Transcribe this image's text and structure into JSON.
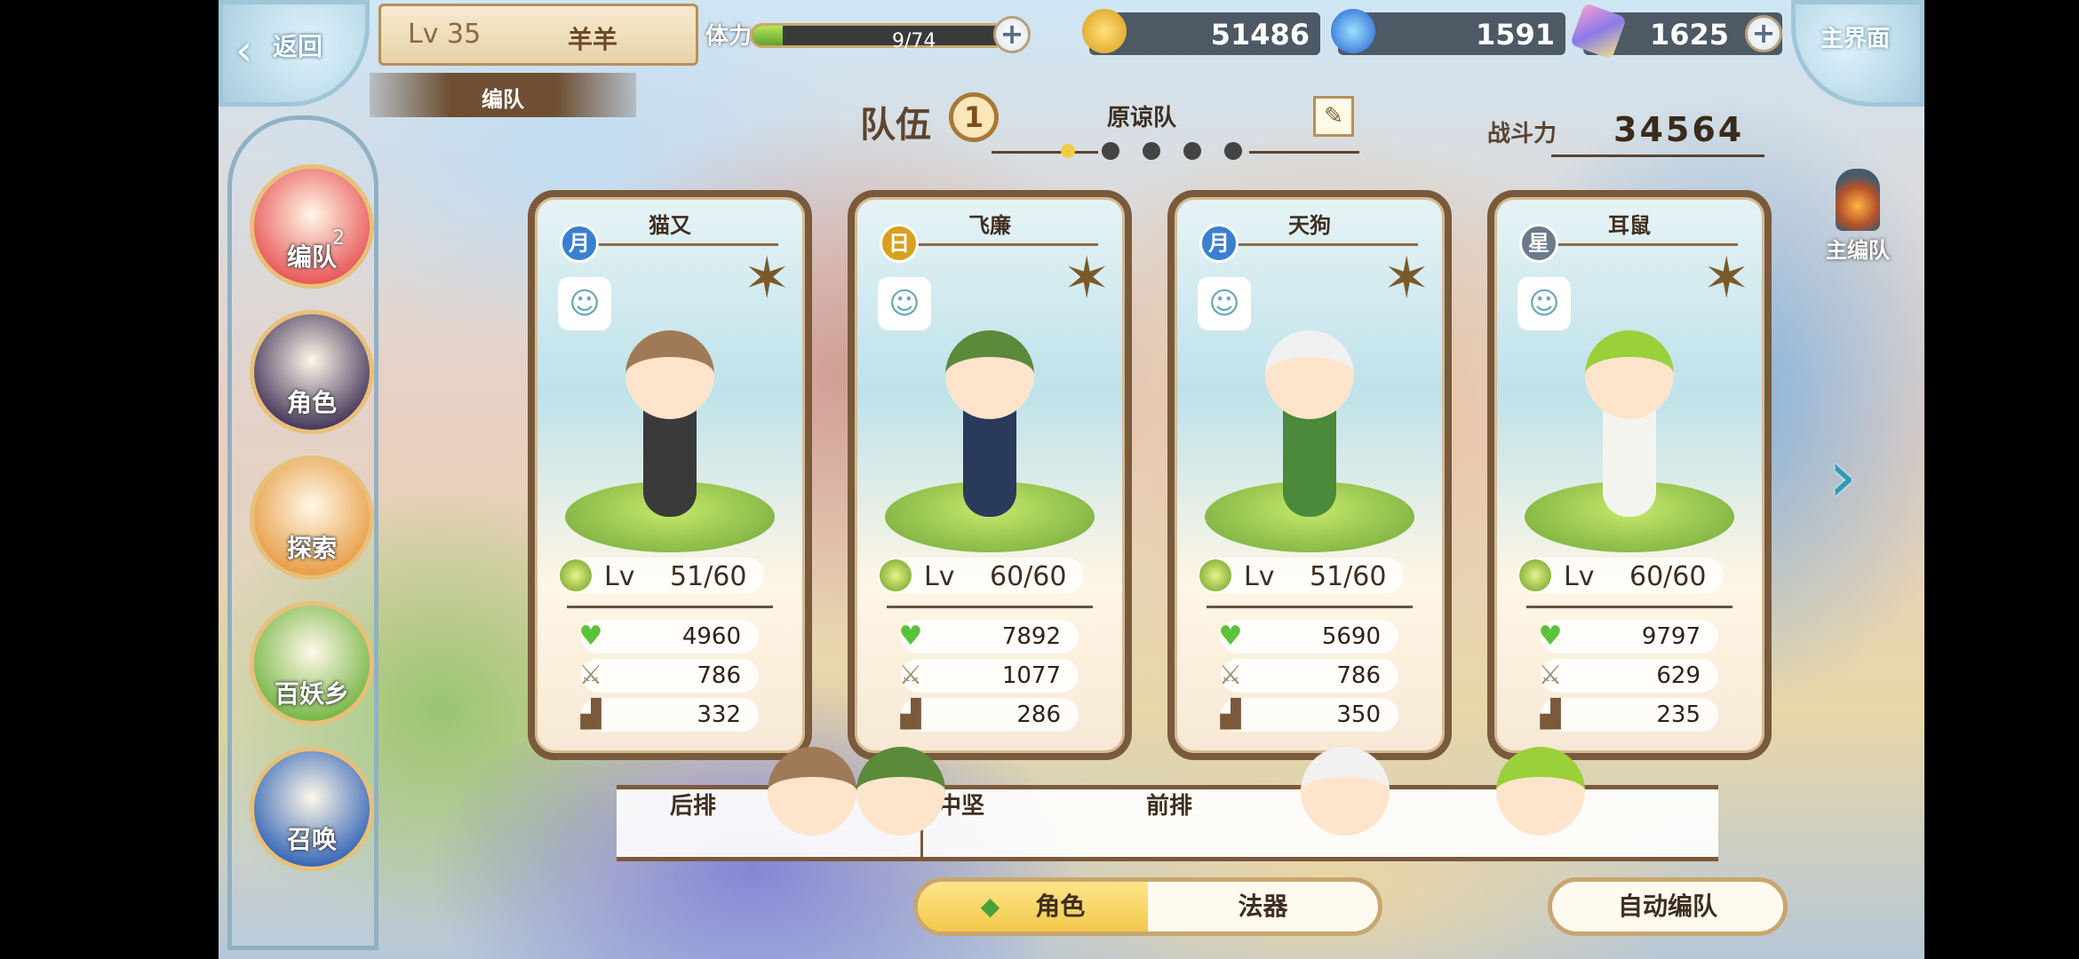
{
  "header": {
    "back_label": "返回",
    "player_level": "Lv 35",
    "player_name": "羊羊",
    "section_title": "编队",
    "stamina_label": "体力",
    "stamina_value": "9/74",
    "stamina_fraction": 0.12,
    "gold": "51486",
    "soul": "1591",
    "crystal": "1625",
    "home_label": "主界面"
  },
  "nav": [
    {
      "label": "编队",
      "badge": "2",
      "icon": "formation-icon",
      "color": "#e85a5a"
    },
    {
      "label": "角色",
      "icon": "character-icon",
      "color": "#4a3b5e"
    },
    {
      "label": "探索",
      "icon": "explore-icon",
      "color": "#e8a04a"
    },
    {
      "label": "百妖乡",
      "icon": "village-icon",
      "color": "#7ab84a"
    },
    {
      "label": "召唤",
      "icon": "summon-icon",
      "color": "#3a6ab8"
    }
  ],
  "team": {
    "label": "队伍",
    "number": "1",
    "name": "原谅队",
    "power_label": "战斗力",
    "power": "34564",
    "page_count": 5,
    "active_page": 0
  },
  "main_team_label": "主编队",
  "cards": [
    {
      "name": "猫又",
      "element": "月",
      "element_color": "#3b7fd0",
      "level_label": "Lv",
      "level": "51/60",
      "hp": "4960",
      "atk": "786",
      "spd": "332",
      "hair": "#a07a56",
      "outfit": "#3a3a3a"
    },
    {
      "name": "飞廉",
      "element": "日",
      "element_color": "#d8a020",
      "level_label": "Lv",
      "level": "60/60",
      "hp": "7892",
      "atk": "1077",
      "spd": "286",
      "hair": "#5a8a3a",
      "outfit": "#2a3a5a"
    },
    {
      "name": "天狗",
      "element": "月",
      "element_color": "#3b7fd0",
      "level_label": "Lv",
      "level": "51/60",
      "hp": "5690",
      "atk": "786",
      "spd": "350",
      "hair": "#f0f0f0",
      "outfit": "#4a8a3a"
    },
    {
      "name": "耳鼠",
      "element": "星",
      "element_color": "#6a7a8a",
      "level_label": "Lv",
      "level": "60/60",
      "hp": "9797",
      "atk": "629",
      "spd": "235",
      "hair": "#9ad03a",
      "outfit": "#f4f4ee"
    }
  ],
  "formation": {
    "back_row": "后排",
    "middle_row": "中坚",
    "front_row": "前排"
  },
  "tabs": {
    "character": "角色",
    "artifact": "法器",
    "auto": "自动编队"
  }
}
